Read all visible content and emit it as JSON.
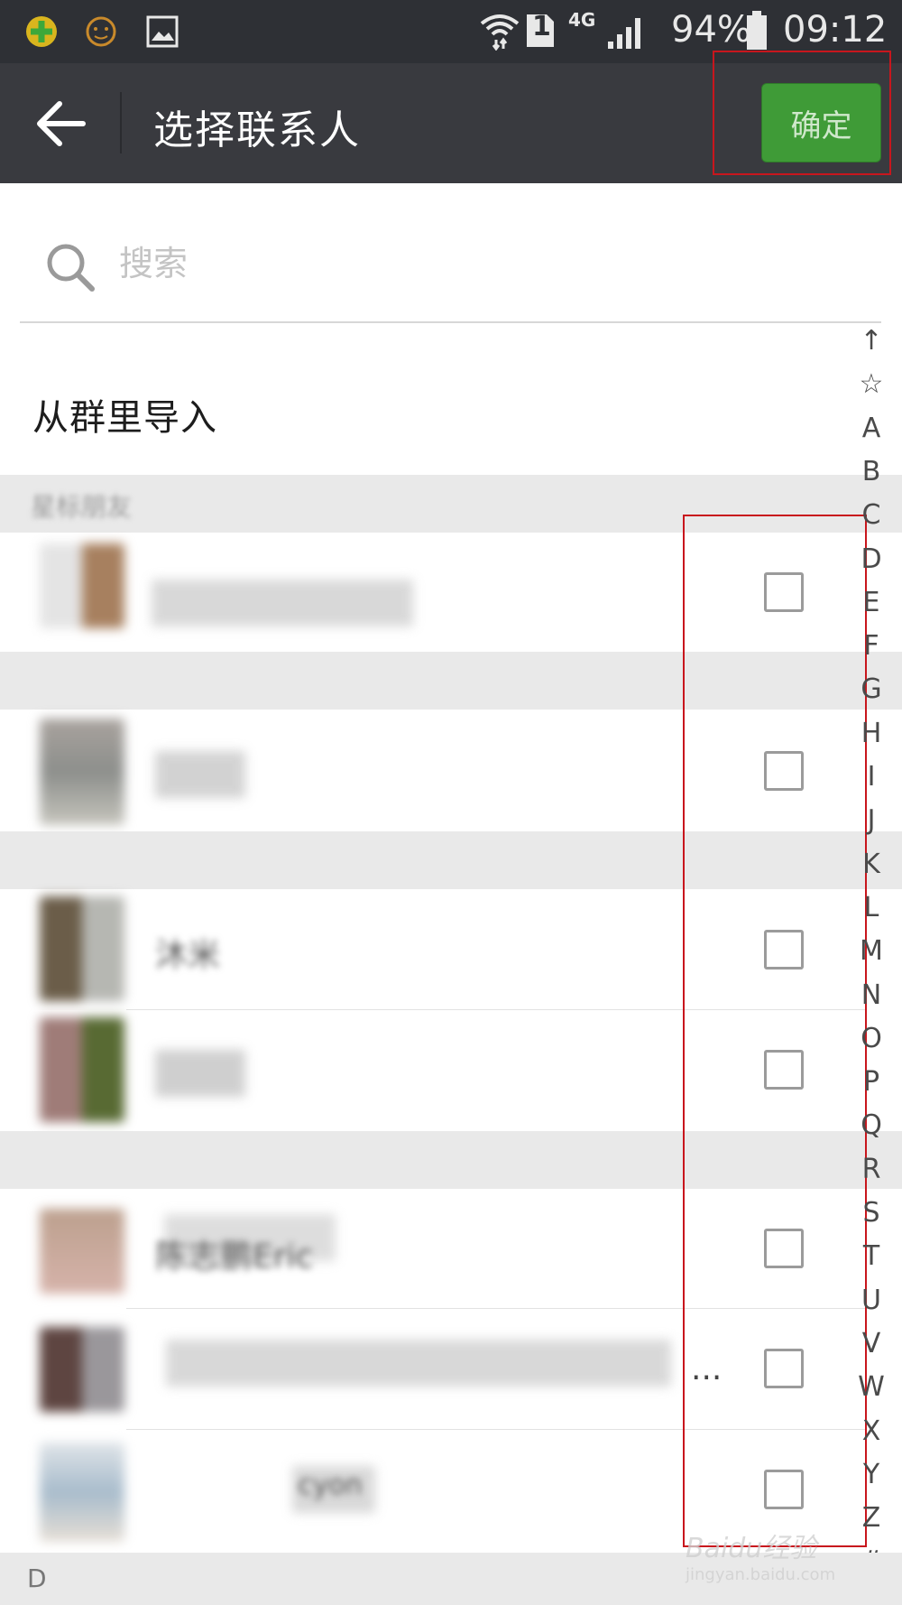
{
  "status_bar": {
    "signal_label": "4G",
    "sim_label": "1",
    "battery": "94%",
    "time": "09:12"
  },
  "header": {
    "title": "选择联系人",
    "confirm_label": "确定"
  },
  "search": {
    "placeholder": "搜索"
  },
  "import_from_group": "从群里导入",
  "sections": {
    "starred": "星标朋友",
    "bottom": "D"
  },
  "contacts": [
    {
      "name": "",
      "checked": false
    },
    {
      "name": "",
      "checked": false
    },
    {
      "name": "沐米",
      "checked": false
    },
    {
      "name": "",
      "checked": false
    },
    {
      "name": "陈志鹏Eric",
      "checked": false
    },
    {
      "name": "",
      "checked": false
    },
    {
      "name": "cyon",
      "checked": false
    }
  ],
  "contact_ellipsis": "...",
  "alphabet_index": [
    "↑",
    "☆",
    "A",
    "B",
    "C",
    "D",
    "E",
    "F",
    "G",
    "H",
    "I",
    "J",
    "K",
    "L",
    "M",
    "N",
    "O",
    "P",
    "Q",
    "R",
    "S",
    "T",
    "U",
    "V",
    "W",
    "X",
    "Y",
    "Z",
    "#"
  ],
  "watermark": {
    "brand": "Baidu经验",
    "url": "jingyan.baidu.com"
  },
  "colors": {
    "status_bar": "#2e3035",
    "title_bar": "#393a3f",
    "confirm_green": "#3f9b37",
    "annotation_red": "#c8161d",
    "section_gray": "#e9e9e9"
  }
}
